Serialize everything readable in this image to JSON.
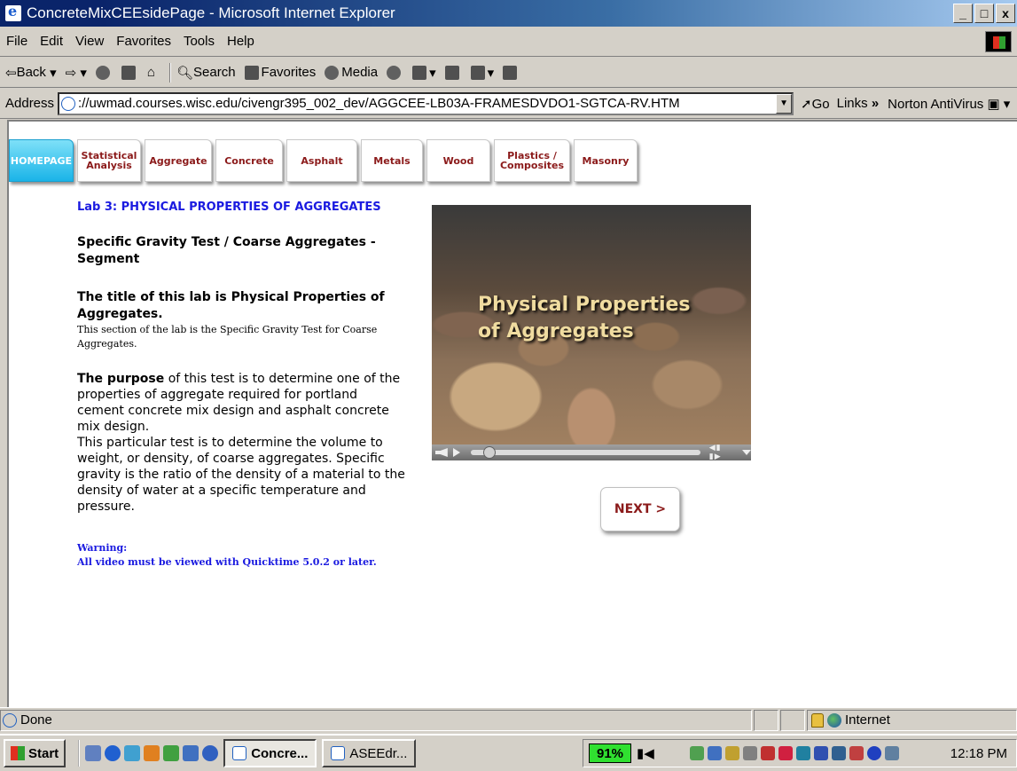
{
  "window": {
    "title": "ConcreteMixCEEsidePage - Microsoft Internet Explorer",
    "controls": [
      "_",
      "□",
      "x"
    ]
  },
  "menu": [
    "File",
    "Edit",
    "View",
    "Favorites",
    "Tools",
    "Help"
  ],
  "toolbar": {
    "back": "Back",
    "search": "Search",
    "favorites": "Favorites",
    "media": "Media"
  },
  "address": {
    "label": "Address",
    "url": "://uwmad.courses.wisc.edu/civengr395_002_dev/AGGCEE-LB03A-FRAMESDVDO1-SGTCA-RV.HTM",
    "go": "Go",
    "links": "Links",
    "norton": "Norton AntiVirus"
  },
  "nav": [
    {
      "label": "HOMEPAGE"
    },
    {
      "label": "Statistical Analysis"
    },
    {
      "label": "Aggregate"
    },
    {
      "label": "Concrete"
    },
    {
      "label": "Asphalt"
    },
    {
      "label": "Metals"
    },
    {
      "label": "Wood"
    },
    {
      "label": "Plastics / Composites"
    },
    {
      "label": "Masonry"
    }
  ],
  "content": {
    "lab_title": "Lab 3: PHYSICAL PROPERTIES OF AGGREGATES",
    "segment_title": "Specific Gravity Test / Coarse Aggregates - Segment",
    "title_heading": "The title of this lab is Physical Properties of Aggregates.",
    "title_sub": "This section of the lab is the Specific Gravity Test for Coarse Aggregates.",
    "purpose_lead": "The purpose",
    "purpose_rest": " of this test is to determine one of the properties of aggregate required for portland cement concrete mix design and asphalt concrete mix design.",
    "purpose_2": "This particular test is to determine the volume to weight, or density, of coarse aggregates. Specific gravity is the ratio of the density of a material to the density of water at a specific temperature and pressure.",
    "warning_1": "Warning:",
    "warning_2": "All video must be viewed with Quicktime 5.0.2 or later.",
    "video_line1": "Physical Properties",
    "video_line2": "of Aggregates",
    "next": "NEXT >"
  },
  "status": {
    "text": "Done",
    "zone": "Internet"
  },
  "taskbar": {
    "start": "Start",
    "tasks": [
      "Concre...",
      "ASEEdr..."
    ],
    "battery": "91%",
    "clock": "12:18 PM"
  }
}
